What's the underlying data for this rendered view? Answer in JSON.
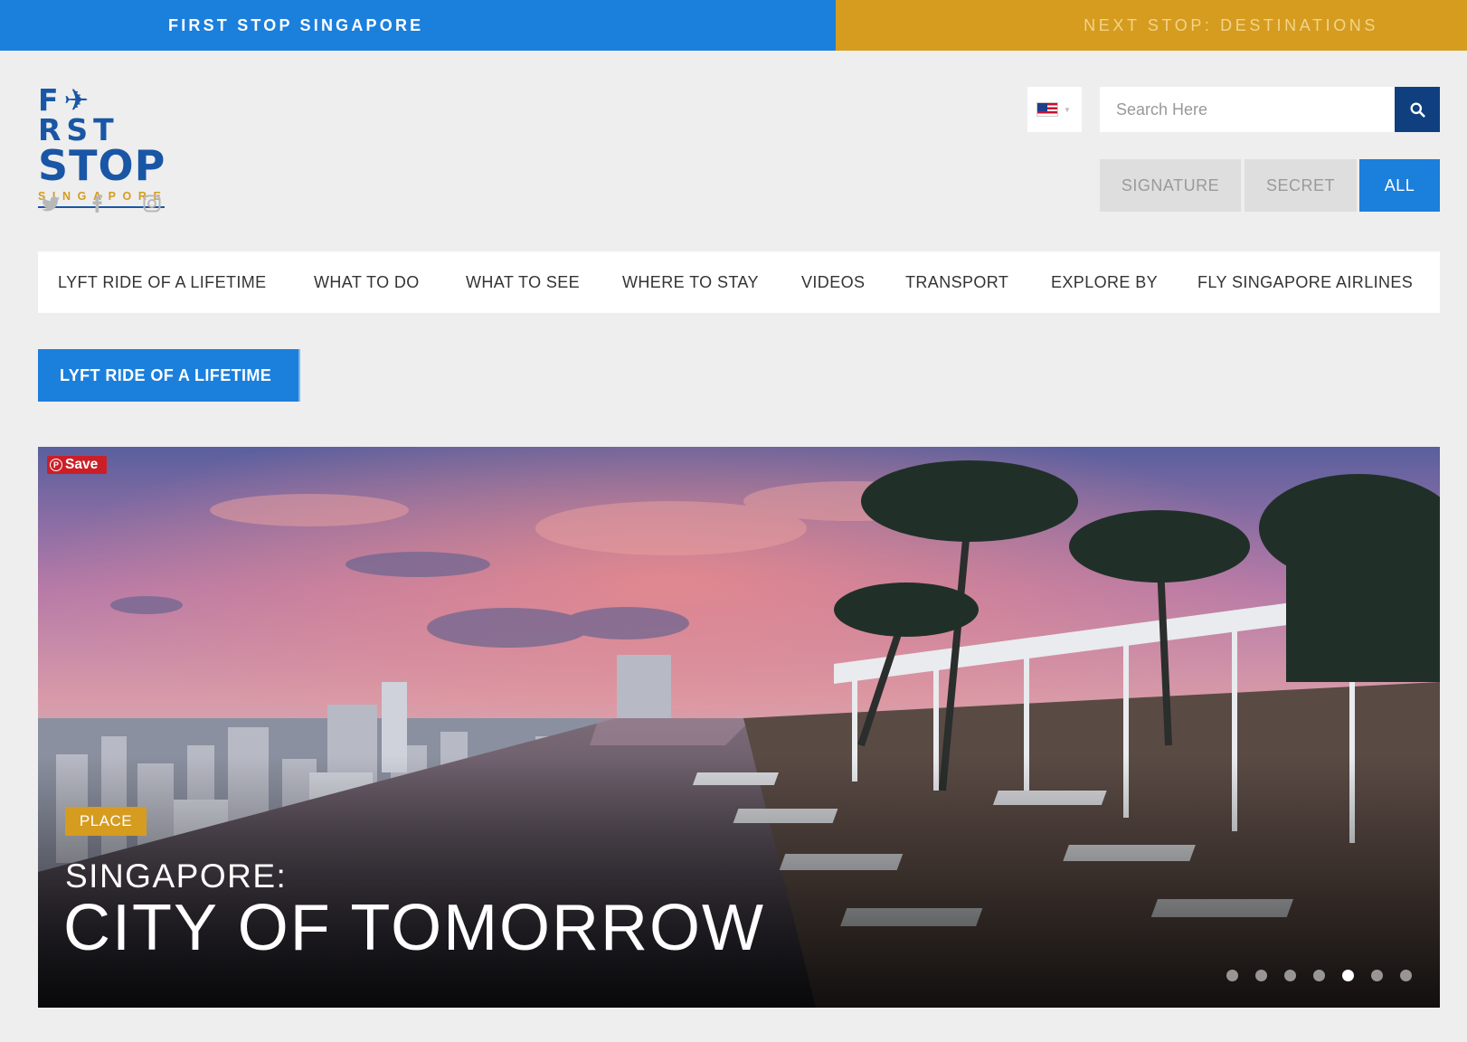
{
  "topbar": {
    "left_label": "FIRST STOP SINGAPORE",
    "right_label": "NEXT STOP: DESTINATIONS"
  },
  "logo": {
    "line1": "F✈RST",
    "line2": "STOP",
    "line3": "SINGAPORE"
  },
  "social": [
    "twitter-icon",
    "facebook-icon",
    "instagram-icon"
  ],
  "search": {
    "placeholder": "Search Here"
  },
  "filters": {
    "signature": "SIGNATURE",
    "secret": "SECRET",
    "all": "ALL",
    "selected": "ALL"
  },
  "nav": {
    "items": [
      "LYFT RIDE OF A LIFETIME",
      "WHAT TO DO",
      "WHAT TO SEE",
      "WHERE TO STAY",
      "VIDEOS",
      "TRANSPORT",
      "EXPLORE BY",
      "FLY SINGAPORE AIRLINES"
    ]
  },
  "lyft_button": "LYFT RIDE OF A LIFETIME",
  "hero": {
    "save_label": "Save",
    "tag": "PLACE",
    "subtitle": "SINGAPORE:",
    "title": "CITY OF TOMORROW",
    "slide_count": 7,
    "active_slide": 5
  },
  "colors": {
    "primary_blue": "#1b7fdc",
    "gold": "#d59c1f",
    "navy": "#103f80",
    "pinterest_red": "#cb1f27"
  }
}
